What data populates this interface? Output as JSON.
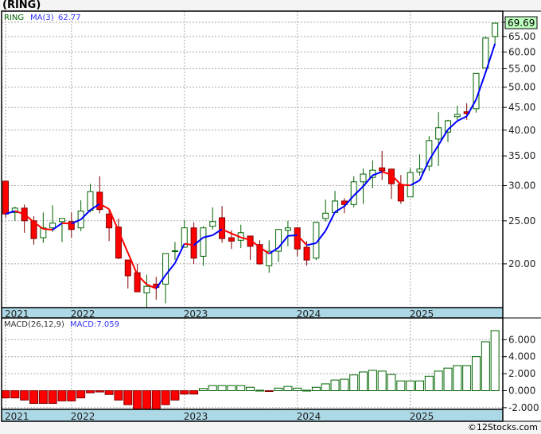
{
  "title": "(RING)",
  "copyright": "©12Stocks.com",
  "colors": {
    "up": "#006400",
    "down": "#ff0000",
    "down_edge": "#800000",
    "ma_up": "#0000ff",
    "ma_down": "#ff0000",
    "axis_band": "#add8e6",
    "last_tag": "#bfffbf"
  },
  "legend": {
    "symbol": "RING",
    "ma_label": "MA(3)",
    "ma_value": "62.77",
    "macd_label": "MACD(26,12,9)",
    "macd_value": "MACD:7.059"
  },
  "last_price": "69.69",
  "chart_data": [
    {
      "type": "candlestick",
      "scale": "log",
      "ylim": [
        14.5,
        72
      ],
      "y_ticks": [
        "20.00",
        "25.00",
        "30.00",
        "35.00",
        "40.00",
        "45.00",
        "50.00",
        "55.00",
        "60.00",
        "65.00",
        "70.00"
      ],
      "x_ticks": [
        {
          "label": "2021",
          "index": 0
        },
        {
          "label": "2022",
          "index": 7
        },
        {
          "label": "2023",
          "index": 19
        },
        {
          "label": "2024",
          "index": 31
        },
        {
          "label": "2025",
          "index": 43
        }
      ],
      "grid": true,
      "categories": [
        "2021-06",
        "2021-07",
        "2021-08",
        "2021-09",
        "2021-10",
        "2021-11",
        "2021-12",
        "2022-01",
        "2022-02",
        "2022-03",
        "2022-04",
        "2022-05",
        "2022-06",
        "2022-07",
        "2022-08",
        "2022-09",
        "2022-10",
        "2022-11",
        "2022-12",
        "2023-01",
        "2023-02",
        "2023-03",
        "2023-04",
        "2023-05",
        "2023-06",
        "2023-07",
        "2023-08",
        "2023-09",
        "2023-10",
        "2023-11",
        "2023-12",
        "2024-01",
        "2024-02",
        "2024-03",
        "2024-04",
        "2024-05",
        "2024-06",
        "2024-07",
        "2024-08",
        "2024-09",
        "2024-10",
        "2024-11",
        "2024-12",
        "2025-01",
        "2025-02",
        "2025-03",
        "2025-04",
        "2025-05",
        "2025-06",
        "2025-07",
        "2025-08",
        "2025-09",
        "2025-10"
      ],
      "ohlc": [
        [
          30.7,
          30.8,
          25.4,
          25.9
        ],
        [
          26.1,
          26.9,
          25.0,
          26.7
        ],
        [
          26.7,
          27.2,
          23.5,
          25.0
        ],
        [
          25.0,
          25.6,
          22.1,
          22.8
        ],
        [
          22.9,
          26.1,
          22.3,
          24.1
        ],
        [
          24.1,
          27.1,
          23.6,
          24.7
        ],
        [
          24.9,
          25.3,
          22.4,
          25.3
        ],
        [
          24.9,
          26.1,
          22.9,
          23.9
        ],
        [
          24.1,
          27.8,
          23.7,
          26.3
        ],
        [
          26.4,
          30.3,
          26.1,
          29.1
        ],
        [
          29.0,
          31.5,
          26.0,
          26.5
        ],
        [
          25.9,
          26.5,
          22.5,
          24.1
        ],
        [
          24.2,
          25.3,
          20.5,
          20.6
        ],
        [
          20.4,
          20.4,
          17.6,
          18.8
        ],
        [
          19.1,
          20.0,
          17.3,
          17.3
        ],
        [
          17.2,
          18.9,
          15.9,
          17.8
        ],
        [
          18.0,
          18.7,
          16.6,
          17.7
        ],
        [
          18.0,
          21.1,
          16.3,
          21.1
        ],
        [
          21.35,
          22.4,
          20.4,
          21.4
        ],
        [
          21.8,
          25.1,
          21.8,
          24.1
        ],
        [
          24.1,
          24.8,
          20.0,
          20.6
        ],
        [
          20.8,
          24.3,
          19.8,
          24.1
        ],
        [
          24.3,
          26.8,
          23.9,
          24.9
        ],
        [
          25.4,
          27.0,
          22.3,
          22.8
        ],
        [
          22.9,
          23.8,
          21.6,
          22.5
        ],
        [
          22.6,
          24.5,
          21.7,
          23.5
        ],
        [
          23.1,
          23.1,
          20.4,
          21.9
        ],
        [
          22.1,
          22.6,
          19.9,
          20.0
        ],
        [
          19.8,
          22.6,
          19.1,
          21.35
        ],
        [
          21.35,
          23.9,
          20.2,
          23.9
        ],
        [
          23.8,
          25.0,
          21.9,
          24.1
        ],
        [
          24.1,
          24.2,
          20.8,
          21.6
        ],
        [
          21.8,
          22.5,
          19.8,
          20.4
        ],
        [
          20.6,
          24.9,
          20.4,
          24.8
        ],
        [
          25.3,
          27.9,
          24.9,
          26.0
        ],
        [
          26.1,
          29.2,
          26.1,
          27.7
        ],
        [
          27.7,
          28.1,
          26.0,
          27.2
        ],
        [
          27.2,
          31.5,
          26.8,
          30.6
        ],
        [
          30.6,
          32.8,
          27.3,
          31.85
        ],
        [
          31.3,
          34.2,
          29.6,
          32.5
        ],
        [
          32.9,
          35.9,
          30.9,
          32.4
        ],
        [
          32.7,
          32.7,
          28.0,
          30.3
        ],
        [
          30.2,
          31.7,
          27.3,
          27.7
        ],
        [
          28.3,
          32.8,
          28.3,
          32.1
        ],
        [
          32.2,
          35.3,
          31.6,
          32.7
        ],
        [
          33.2,
          38.8,
          32.4,
          37.9
        ],
        [
          38.2,
          43.9,
          33.2,
          40.5
        ],
        [
          39.6,
          42.2,
          37.6,
          42.0
        ],
        [
          42.9,
          45.4,
          42.0,
          43.4
        ],
        [
          44.0,
          46.0,
          42.2,
          43.6
        ],
        [
          44.7,
          53.7,
          43.8,
          53.7
        ],
        [
          55.2,
          65.0,
          55.2,
          64.5
        ],
        [
          65.0,
          69.8,
          62.1,
          69.69
        ]
      ],
      "ma_period": 3
    },
    {
      "type": "bar",
      "title": "MACD(26,12,9)",
      "ylim": [
        -2.2,
        7.3
      ],
      "y_ticks": [
        "6.000",
        "4.000",
        "2.000",
        "0.000",
        "-2.000"
      ],
      "y_tick_values": [
        6,
        4,
        2,
        0,
        -2
      ],
      "values": [
        -0.85,
        -0.85,
        -1.1,
        -1.5,
        -1.5,
        -1.5,
        -1.2,
        -1.2,
        -0.85,
        -0.25,
        -0.15,
        -0.45,
        -1.1,
        -1.65,
        -2.3,
        -2.4,
        -2.4,
        -1.65,
        -1.1,
        -0.4,
        -0.4,
        0.25,
        0.6,
        0.6,
        0.6,
        0.6,
        0.4,
        0.05,
        -0.05,
        0.3,
        0.5,
        0.3,
        0.05,
        0.4,
        0.8,
        1.25,
        1.35,
        1.85,
        2.2,
        2.4,
        2.3,
        1.9,
        1.15,
        1.15,
        1.15,
        1.7,
        2.3,
        2.65,
        2.95,
        2.95,
        4.0,
        5.75,
        7.059
      ]
    }
  ]
}
